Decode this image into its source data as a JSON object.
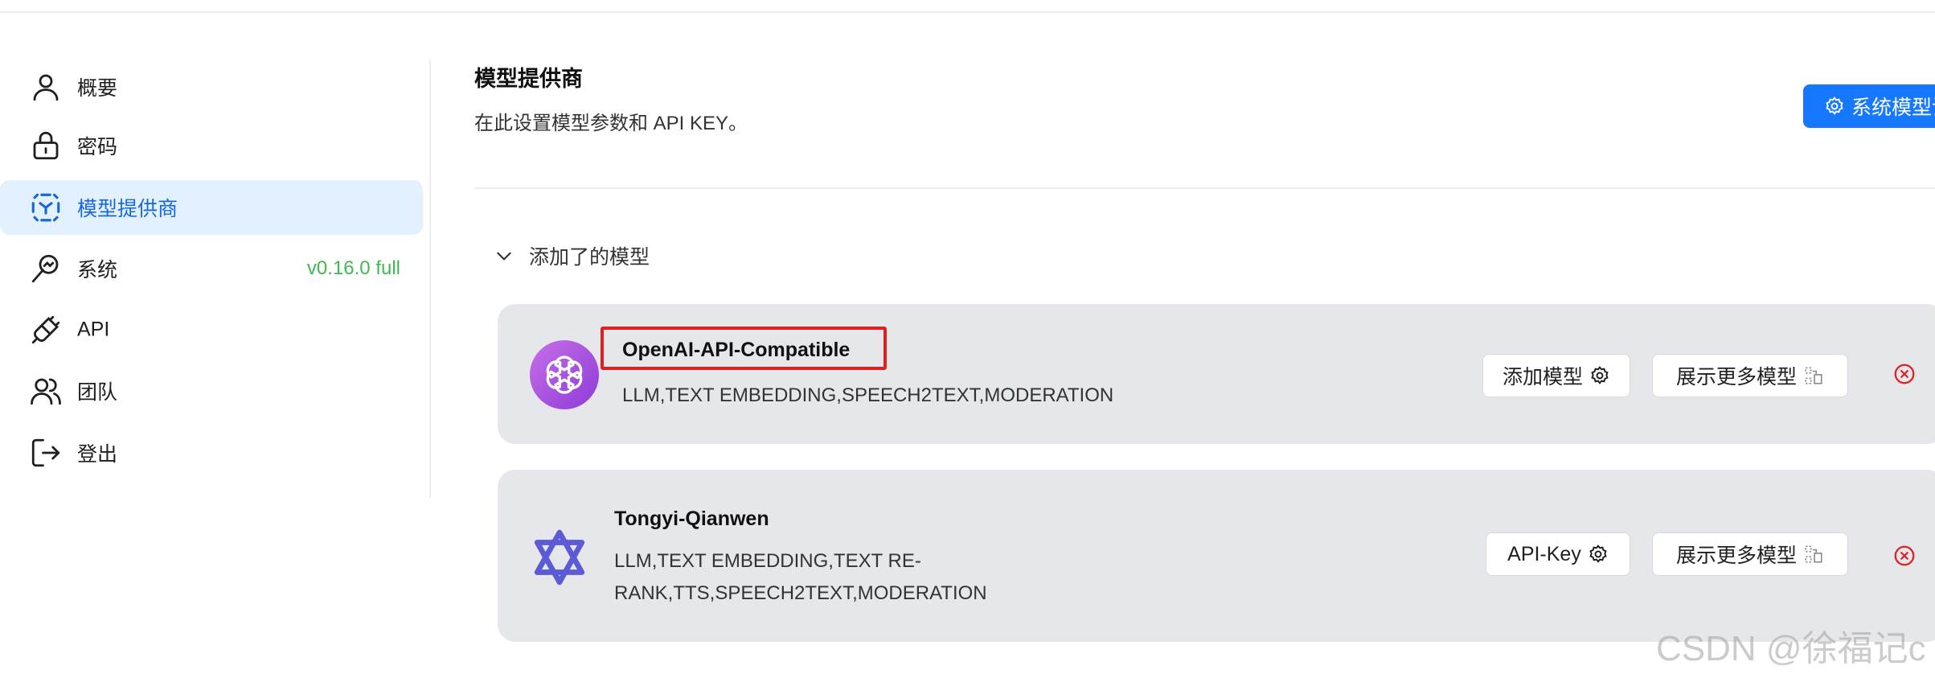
{
  "sidebar": {
    "items": [
      {
        "label": "概要",
        "icon": "user-icon"
      },
      {
        "label": "密码",
        "icon": "lock-icon"
      },
      {
        "label": "模型提供商",
        "icon": "model-provider-icon",
        "active": true
      },
      {
        "label": "系统",
        "icon": "system-icon",
        "badge": "v0.16.0 full"
      },
      {
        "label": "API",
        "icon": "plug-icon"
      },
      {
        "label": "团队",
        "icon": "team-icon"
      },
      {
        "label": "登出",
        "icon": "logout-icon"
      }
    ]
  },
  "header": {
    "title": "模型提供商",
    "subtitle": "在此设置模型参数和 API KEY。",
    "system_button": "系统模型设置"
  },
  "section": {
    "label": "添加了的模型"
  },
  "providers": [
    {
      "name": "OpenAI-API-Compatible",
      "types": "LLM,TEXT EMBEDDING,SPEECH2TEXT,MODERATION",
      "primary_button": "添加模型",
      "more_button": "展示更多模型"
    },
    {
      "name": "Tongyi-Qianwen",
      "types_line1": "LLM,TEXT EMBEDDING,TEXT RE-",
      "types_line2": "RANK,TTS,SPEECH2TEXT,MODERATION",
      "primary_button": "API-Key",
      "more_button": "展示更多模型"
    }
  ],
  "watermark": "CSDN @徐福记c",
  "colors": {
    "accent": "#1677ff",
    "active_bg": "#e3f0fd",
    "card_bg": "#e6e7eb",
    "version": "#3fb950",
    "remove": "#e02020"
  }
}
